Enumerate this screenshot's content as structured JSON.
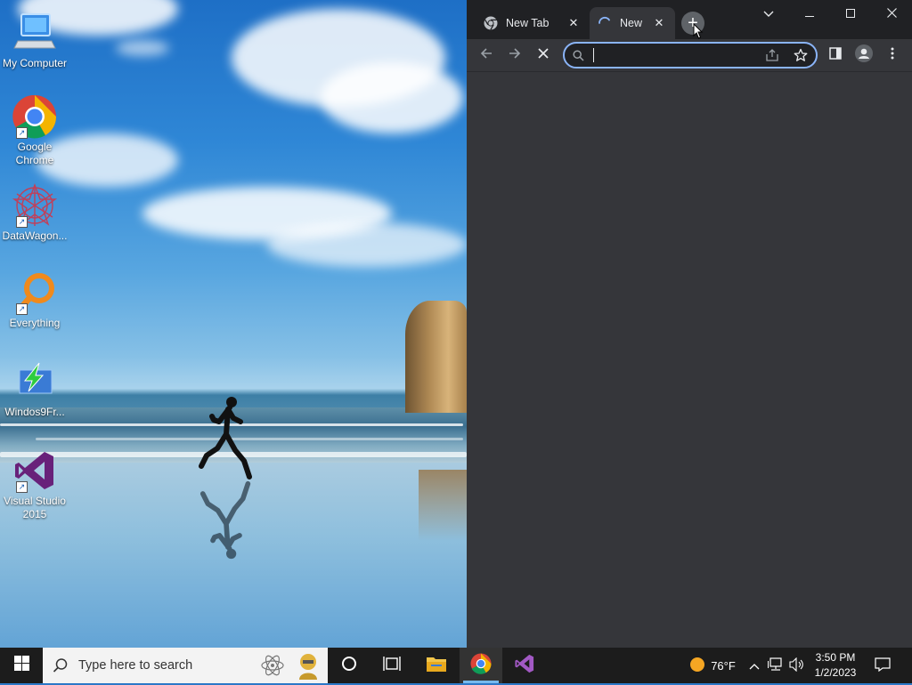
{
  "desktop": {
    "icons": [
      {
        "label": "My Computer"
      },
      {
        "label": "Google Chrome"
      },
      {
        "label": "DataWagon..."
      },
      {
        "label": "Everything"
      },
      {
        "label": "Windos9Fr..."
      },
      {
        "label": "Visual Studio 2015"
      }
    ]
  },
  "browser": {
    "tabs": [
      {
        "title": "New Tab",
        "icon": "chrome-icon"
      },
      {
        "title": "New",
        "icon": "loading-spinner-icon"
      }
    ],
    "omnibox": {
      "value": "",
      "placeholder": ""
    },
    "theme": {
      "frame": "#202124",
      "toolbar": "#35363a",
      "accent": "#8ab4f8"
    }
  },
  "taskbar": {
    "search_placeholder": "Type here to search",
    "weather": "76°F",
    "time": "3:50 PM",
    "date": "1/2/2023"
  }
}
